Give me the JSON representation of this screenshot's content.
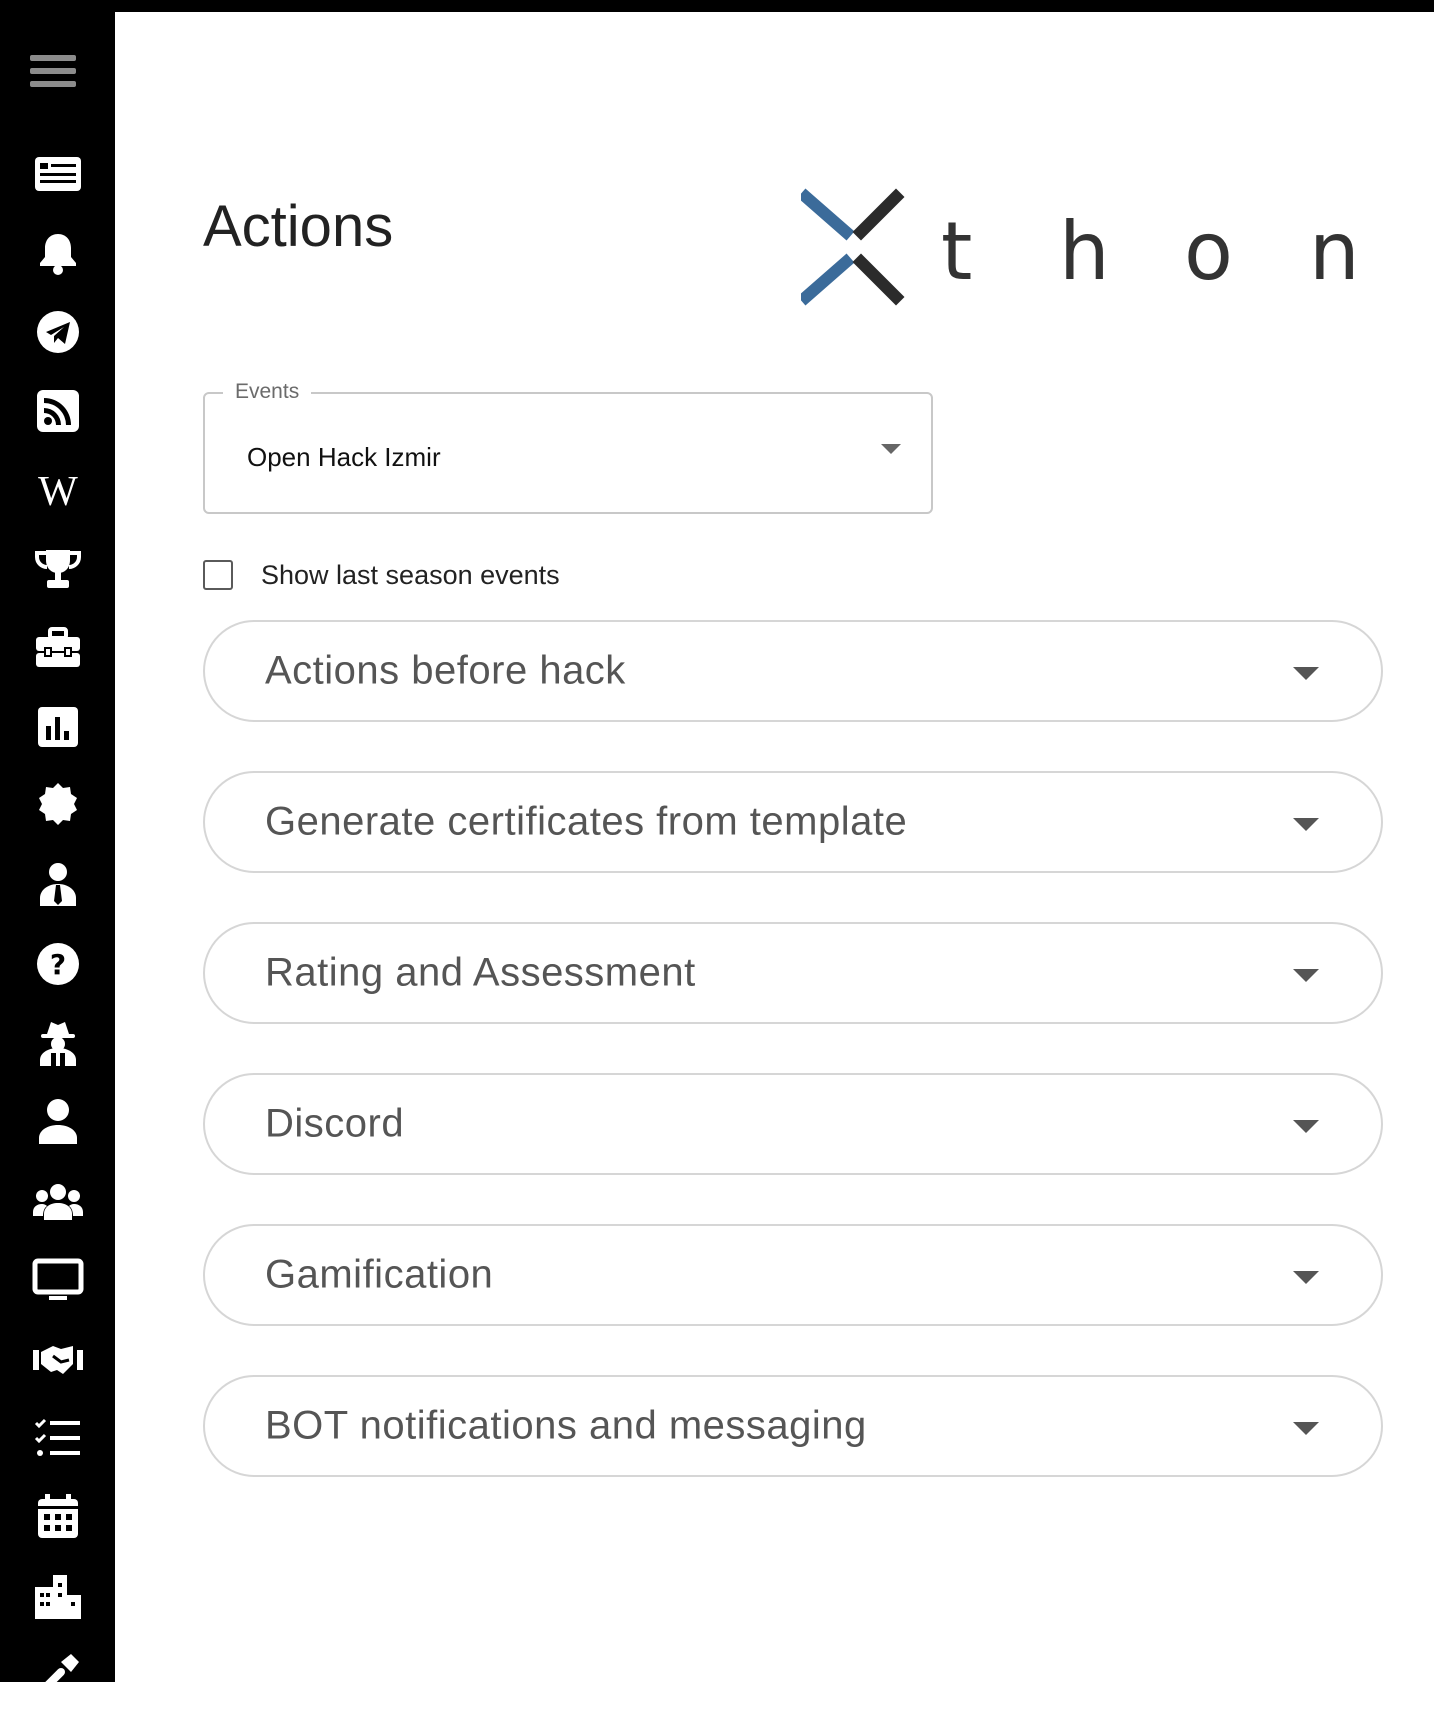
{
  "page": {
    "title": "Actions"
  },
  "logo": {
    "letters": [
      "t",
      "h",
      "o",
      "n"
    ]
  },
  "events": {
    "label": "Events",
    "value": "Open Hack Izmir"
  },
  "checkbox": {
    "label": "Show last season events",
    "checked": false
  },
  "sections": [
    {
      "label": "Actions before hack"
    },
    {
      "label": "Generate certificates from template"
    },
    {
      "label": "Rating and Assessment"
    },
    {
      "label": "Discord"
    },
    {
      "label": "Gamification"
    },
    {
      "label": "BOT notifications and messaging"
    }
  ],
  "sidebar": {
    "icons": [
      "menu-icon",
      "news-icon",
      "bell-icon",
      "telegram-icon",
      "rss-icon",
      "wikipedia-icon",
      "trophy-icon",
      "toolbox-icon",
      "chart-icon",
      "certificate-badge-icon",
      "mentor-icon",
      "help-icon",
      "spy-icon",
      "user-icon",
      "users-icon",
      "monitor-icon",
      "handshake-icon",
      "tasks-icon",
      "calendar-icon",
      "city-icon",
      "tools-icon"
    ]
  },
  "colors": {
    "sidebar": "#000000",
    "logo_blue": "#3b6b9a",
    "logo_dark": "#2b2b2b"
  }
}
